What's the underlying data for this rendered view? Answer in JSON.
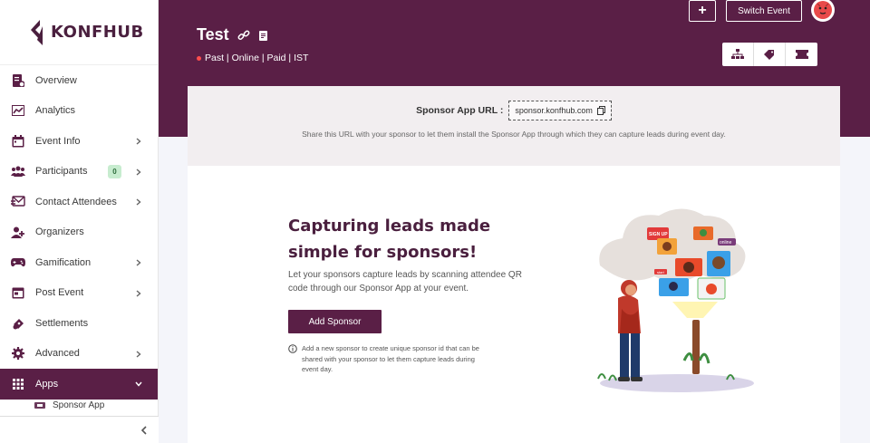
{
  "brand": {
    "name": "KONFHUB"
  },
  "sidebar": {
    "items": [
      {
        "label": "Overview",
        "icon": "overview-icon",
        "chevron": false
      },
      {
        "label": "Analytics",
        "icon": "analytics-icon",
        "chevron": false
      },
      {
        "label": "Event Info",
        "icon": "event-info-icon",
        "chevron": true
      },
      {
        "label": "Participants",
        "icon": "participants-icon",
        "chevron": true,
        "badge": "0"
      },
      {
        "label": "Contact Attendees",
        "icon": "contact-attendees-icon",
        "chevron": true
      },
      {
        "label": "Organizers",
        "icon": "organizers-icon",
        "chevron": false
      },
      {
        "label": "Gamification",
        "icon": "gamification-icon",
        "chevron": true
      },
      {
        "label": "Post Event",
        "icon": "post-event-icon",
        "chevron": true
      },
      {
        "label": "Settlements",
        "icon": "settlements-icon",
        "chevron": false
      },
      {
        "label": "Advanced",
        "icon": "advanced-icon",
        "chevron": true
      },
      {
        "label": "Apps",
        "icon": "apps-icon",
        "chevron": true,
        "active": true
      }
    ],
    "sub_item": {
      "label": "Sponsor App",
      "icon": "sponsor-app-icon"
    },
    "collapse_icon": "chevron-left-icon"
  },
  "header": {
    "event_title": "Test",
    "event_meta": "Past | Online | Paid | IST",
    "add_label": "+",
    "switch_event_label": "Switch Event",
    "tools": [
      "org-chart-icon",
      "tag-icon",
      "ticket-icon"
    ],
    "accent": "#5a1f46"
  },
  "url_panel": {
    "label": "Sponsor App URL :",
    "url": "sponsor.konfhub.com",
    "hint": "Share this URL with your sponsor to let them install the Sponsor App through which they can capture leads during event day."
  },
  "main": {
    "title": "Capturing leads made simple for sponsors!",
    "description": "Let your sponsors capture leads by scanning attendee QR code through our Sponsor App at your event.",
    "add_button": "Add Sponsor",
    "info": "Add a new sponsor to create unique sponsor id that can be shared with your sponsor to let them capture leads during event day.",
    "illustration_tags": [
      "SIGN UP",
      "online",
      "start"
    ]
  }
}
